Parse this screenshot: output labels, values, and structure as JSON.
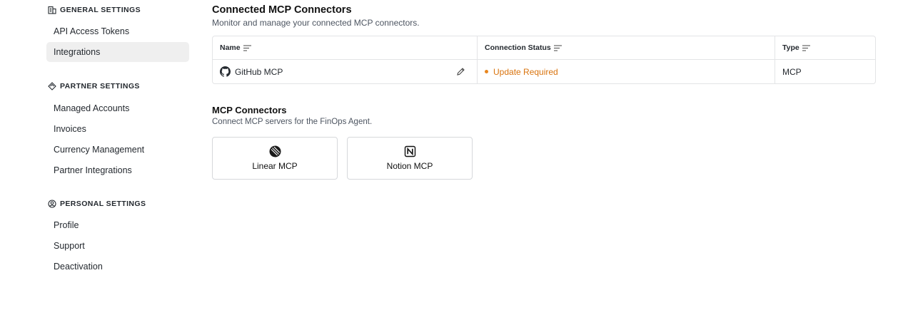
{
  "sidebar": {
    "sections": [
      {
        "title": "GENERAL SETTINGS",
        "icon": "building-icon",
        "items": [
          {
            "label": "API Access Tokens",
            "active": false
          },
          {
            "label": "Integrations",
            "active": true
          }
        ]
      },
      {
        "title": "PARTNER SETTINGS",
        "icon": "handshake-icon",
        "items": [
          {
            "label": "Managed Accounts"
          },
          {
            "label": "Invoices"
          },
          {
            "label": "Currency Management"
          },
          {
            "label": "Partner Integrations"
          }
        ]
      },
      {
        "title": "PERSONAL SETTINGS",
        "icon": "user-circle-icon",
        "items": [
          {
            "label": "Profile"
          },
          {
            "label": "Support"
          },
          {
            "label": "Deactivation"
          }
        ]
      }
    ]
  },
  "connected": {
    "title": "Connected MCP Connectors",
    "subtitle": "Monitor and manage your connected MCP connectors.",
    "columns": [
      "Name",
      "Connection Status",
      "Type"
    ],
    "rows": [
      {
        "name": "GitHub MCP",
        "icon": "github-icon",
        "status": "Update Required",
        "type": "MCP"
      }
    ]
  },
  "available": {
    "title": "MCP Connectors",
    "subtitle": "Connect MCP servers for the FinOps Agent.",
    "cards": [
      {
        "label": "Linear MCP",
        "icon": "linear-logo-icon"
      },
      {
        "label": "Notion MCP",
        "icon": "notion-logo-icon"
      }
    ]
  },
  "colors": {
    "status_warning": "#d9730d",
    "active_bg": "#efefef",
    "border": "#e3e4e6"
  }
}
